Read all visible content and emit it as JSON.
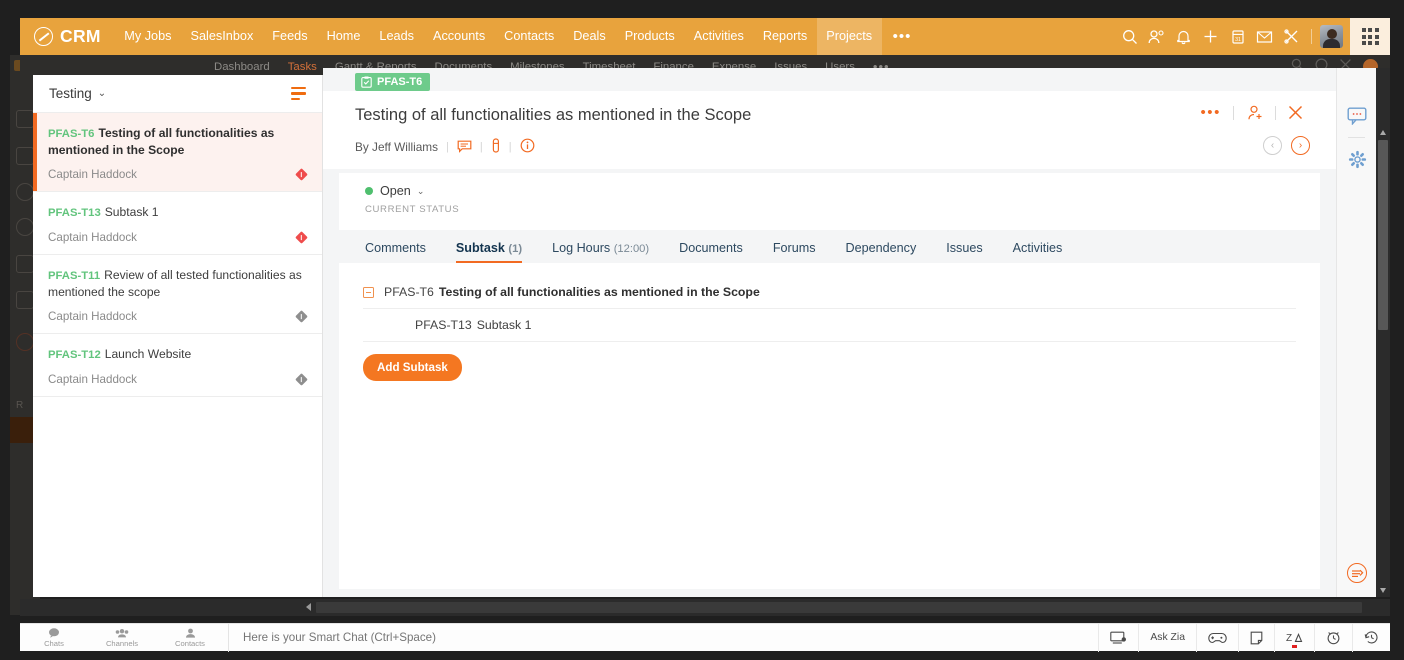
{
  "topnav": {
    "brand": "CRM",
    "brand_icon": "zoho-circle-icon",
    "items": [
      {
        "label": "My Jobs",
        "active": false
      },
      {
        "label": "SalesInbox",
        "active": false
      },
      {
        "label": "Feeds",
        "active": false
      },
      {
        "label": "Home",
        "active": false
      },
      {
        "label": "Leads",
        "active": false
      },
      {
        "label": "Accounts",
        "active": false
      },
      {
        "label": "Contacts",
        "active": false
      },
      {
        "label": "Deals",
        "active": false
      },
      {
        "label": "Products",
        "active": false
      },
      {
        "label": "Activities",
        "active": false
      },
      {
        "label": "Reports",
        "active": false
      },
      {
        "label": "Projects",
        "active": true
      }
    ],
    "more_label": "•••",
    "icons": [
      "search-icon",
      "users-icon",
      "bell-icon",
      "plus-icon",
      "calendar-icon",
      "envelope-icon",
      "tools-icon"
    ],
    "avatar_name": "user-avatar",
    "apps_icon": "apps-grid-icon",
    "bg_color": "#e8a33d",
    "active_bg_color": "#edb563"
  },
  "subnav": {
    "items": [
      {
        "label": "Dashboard",
        "active": false
      },
      {
        "label": "Tasks",
        "active": true
      },
      {
        "label": "Gantt & Reports",
        "active": false
      },
      {
        "label": "Documents",
        "active": false
      },
      {
        "label": "Milestones",
        "active": false
      },
      {
        "label": "Timesheet",
        "active": false
      },
      {
        "label": "Finance",
        "active": false
      },
      {
        "label": "Expense",
        "active": false
      },
      {
        "label": "Issues",
        "active": false
      },
      {
        "label": "Users",
        "active": false
      }
    ],
    "more_label": "•••",
    "bg_color": "#2e2d2b",
    "active_color": "#d2703a"
  },
  "tasklist": {
    "title": "Testing",
    "caret": "⌄",
    "filter_icon": "filter-lines-icon",
    "items": [
      {
        "key": "PFAS-T6",
        "name": "Testing of all functionalities as mentioned in the Scope",
        "owner": "Captain Haddock",
        "priority": "high",
        "selected": true
      },
      {
        "key": "PFAS-T13",
        "name": "Subtask 1",
        "owner": "Captain Haddock",
        "priority": "high",
        "selected": false
      },
      {
        "key": "PFAS-T11",
        "name": "Review of all tested functionalities as mentioned the scope",
        "owner": "Captain Haddock",
        "priority": "normal",
        "selected": false
      },
      {
        "key": "PFAS-T12",
        "name": "Launch Website",
        "owner": "Captain Haddock",
        "priority": "normal",
        "selected": false
      }
    ]
  },
  "detail": {
    "badge": "PFAS-T6",
    "badge_icon": "clipboard-check-icon",
    "badge_color": "#6ecb8b",
    "title": "Testing of all functionalities as mentioned in the Scope",
    "by": "By Jeff Williams",
    "meta_icons": [
      "comment-icon",
      "attachment-icon",
      "info-icon"
    ],
    "actions": {
      "more_label": "•••",
      "assign_icon": "add-assignee-icon",
      "close_icon": "close-icon"
    },
    "nav": {
      "prev": "‹",
      "next": "›"
    },
    "status": {
      "value": "Open",
      "caret": "⌄",
      "label": "CURRENT STATUS",
      "color": "#4fbf6e"
    },
    "tabs": [
      {
        "label": "Comments",
        "sub": "",
        "active": false
      },
      {
        "label": "Subtask",
        "sub": "(1)",
        "active": true
      },
      {
        "label": "Log Hours",
        "sub": "(12:00)",
        "active": false
      },
      {
        "label": "Documents",
        "sub": "",
        "active": false
      },
      {
        "label": "Forums",
        "sub": "",
        "active": false
      },
      {
        "label": "Dependency",
        "sub": "",
        "active": false
      },
      {
        "label": "Issues",
        "sub": "",
        "active": false
      },
      {
        "label": "Activities",
        "sub": "",
        "active": false
      }
    ],
    "subtasks": {
      "parent": {
        "key": "PFAS-T6",
        "name": "Testing of all functionalities as mentioned in the Scope"
      },
      "children": [
        {
          "key": "PFAS-T13",
          "name": "Subtask 1"
        }
      ],
      "add_label": "Add Subtask",
      "add_color": "#f47721"
    }
  },
  "rail": {
    "icons": [
      "chat-bubble-icon",
      "settings-gear-icon"
    ],
    "bottom_icon": "collapse-panel-icon"
  },
  "chatbar": {
    "buttons": [
      {
        "label": "Chats",
        "icon": "chat-icon"
      },
      {
        "label": "Channels",
        "icon": "channels-icon"
      },
      {
        "label": "Contacts",
        "icon": "contact-icon"
      }
    ],
    "placeholder": "Here is your Smart Chat (Ctrl+Space)",
    "value": "",
    "right_items": [
      {
        "label": "",
        "icon": "screenshare-icon"
      },
      {
        "label": "Ask Zia",
        "icon": ""
      },
      {
        "label": "",
        "icon": "gamepad-icon"
      },
      {
        "label": "",
        "icon": "notes-icon"
      },
      {
        "label": "",
        "icon": "zia-analytics-icon",
        "badge": true
      },
      {
        "label": "",
        "icon": "alarm-clock-icon"
      },
      {
        "label": "",
        "icon": "history-clock-icon"
      }
    ]
  }
}
